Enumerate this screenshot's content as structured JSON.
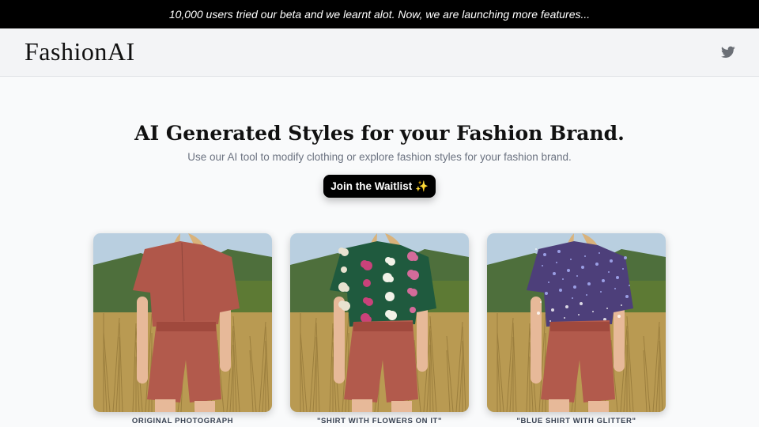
{
  "announcement": {
    "text": "10,000 users tried our beta and we learnt alot. Now, we are launching more features..."
  },
  "navbar": {
    "logo": "FashionAI",
    "social_icon": "twitter-icon"
  },
  "hero": {
    "title": "AI Generated Styles for your Fashion Brand.",
    "subtitle": "Use our AI tool to modify clothing or explore fashion styles for your fashion brand.",
    "cta_label": "Join the Waitlist ✨"
  },
  "gallery": [
    {
      "caption": "ORIGINAL PHOTOGRAPH",
      "shirt_color": "#b0574a",
      "shirt_style": "plain"
    },
    {
      "caption": "\"SHIRT WITH FLOWERS ON IT\"",
      "shirt_color": "#1f5a3e",
      "shirt_style": "floral"
    },
    {
      "caption": "\"BLUE SHIRT WITH GLITTER\"",
      "shirt_color": "#4d3f7a",
      "shirt_style": "glitter"
    }
  ],
  "colors": {
    "shorts": "#b25a4c",
    "sky": "#b9cfe0",
    "hills": "#4e6f3c",
    "grass": "#b99a52",
    "hair": "#d9b27a",
    "skin": "#e7b999"
  }
}
